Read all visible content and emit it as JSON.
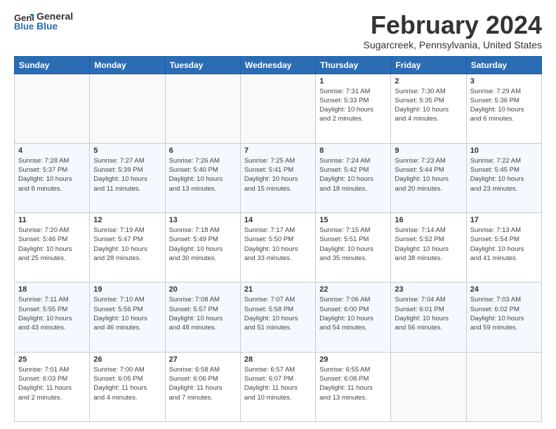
{
  "header": {
    "logo_general": "General",
    "logo_blue": "Blue",
    "month_title": "February 2024",
    "location": "Sugarcreek, Pennsylvania, United States"
  },
  "weekdays": [
    "Sunday",
    "Monday",
    "Tuesday",
    "Wednesday",
    "Thursday",
    "Friday",
    "Saturday"
  ],
  "weeks": [
    [
      {
        "day": "",
        "info": ""
      },
      {
        "day": "",
        "info": ""
      },
      {
        "day": "",
        "info": ""
      },
      {
        "day": "",
        "info": ""
      },
      {
        "day": "1",
        "info": "Sunrise: 7:31 AM\nSunset: 5:33 PM\nDaylight: 10 hours\nand 2 minutes."
      },
      {
        "day": "2",
        "info": "Sunrise: 7:30 AM\nSunset: 5:35 PM\nDaylight: 10 hours\nand 4 minutes."
      },
      {
        "day": "3",
        "info": "Sunrise: 7:29 AM\nSunset: 5:36 PM\nDaylight: 10 hours\nand 6 minutes."
      }
    ],
    [
      {
        "day": "4",
        "info": "Sunrise: 7:28 AM\nSunset: 5:37 PM\nDaylight: 10 hours\nand 8 minutes."
      },
      {
        "day": "5",
        "info": "Sunrise: 7:27 AM\nSunset: 5:39 PM\nDaylight: 10 hours\nand 11 minutes."
      },
      {
        "day": "6",
        "info": "Sunrise: 7:26 AM\nSunset: 5:40 PM\nDaylight: 10 hours\nand 13 minutes."
      },
      {
        "day": "7",
        "info": "Sunrise: 7:25 AM\nSunset: 5:41 PM\nDaylight: 10 hours\nand 15 minutes."
      },
      {
        "day": "8",
        "info": "Sunrise: 7:24 AM\nSunset: 5:42 PM\nDaylight: 10 hours\nand 18 minutes."
      },
      {
        "day": "9",
        "info": "Sunrise: 7:23 AM\nSunset: 5:44 PM\nDaylight: 10 hours\nand 20 minutes."
      },
      {
        "day": "10",
        "info": "Sunrise: 7:22 AM\nSunset: 5:45 PM\nDaylight: 10 hours\nand 23 minutes."
      }
    ],
    [
      {
        "day": "11",
        "info": "Sunrise: 7:20 AM\nSunset: 5:46 PM\nDaylight: 10 hours\nand 25 minutes."
      },
      {
        "day": "12",
        "info": "Sunrise: 7:19 AM\nSunset: 5:47 PM\nDaylight: 10 hours\nand 28 minutes."
      },
      {
        "day": "13",
        "info": "Sunrise: 7:18 AM\nSunset: 5:49 PM\nDaylight: 10 hours\nand 30 minutes."
      },
      {
        "day": "14",
        "info": "Sunrise: 7:17 AM\nSunset: 5:50 PM\nDaylight: 10 hours\nand 33 minutes."
      },
      {
        "day": "15",
        "info": "Sunrise: 7:15 AM\nSunset: 5:51 PM\nDaylight: 10 hours\nand 35 minutes."
      },
      {
        "day": "16",
        "info": "Sunrise: 7:14 AM\nSunset: 5:52 PM\nDaylight: 10 hours\nand 38 minutes."
      },
      {
        "day": "17",
        "info": "Sunrise: 7:13 AM\nSunset: 5:54 PM\nDaylight: 10 hours\nand 41 minutes."
      }
    ],
    [
      {
        "day": "18",
        "info": "Sunrise: 7:11 AM\nSunset: 5:55 PM\nDaylight: 10 hours\nand 43 minutes."
      },
      {
        "day": "19",
        "info": "Sunrise: 7:10 AM\nSunset: 5:56 PM\nDaylight: 10 hours\nand 46 minutes."
      },
      {
        "day": "20",
        "info": "Sunrise: 7:08 AM\nSunset: 5:57 PM\nDaylight: 10 hours\nand 48 minutes."
      },
      {
        "day": "21",
        "info": "Sunrise: 7:07 AM\nSunset: 5:58 PM\nDaylight: 10 hours\nand 51 minutes."
      },
      {
        "day": "22",
        "info": "Sunrise: 7:06 AM\nSunset: 6:00 PM\nDaylight: 10 hours\nand 54 minutes."
      },
      {
        "day": "23",
        "info": "Sunrise: 7:04 AM\nSunset: 6:01 PM\nDaylight: 10 hours\nand 56 minutes."
      },
      {
        "day": "24",
        "info": "Sunrise: 7:03 AM\nSunset: 6:02 PM\nDaylight: 10 hours\nand 59 minutes."
      }
    ],
    [
      {
        "day": "25",
        "info": "Sunrise: 7:01 AM\nSunset: 6:03 PM\nDaylight: 11 hours\nand 2 minutes."
      },
      {
        "day": "26",
        "info": "Sunrise: 7:00 AM\nSunset: 6:05 PM\nDaylight: 11 hours\nand 4 minutes."
      },
      {
        "day": "27",
        "info": "Sunrise: 6:58 AM\nSunset: 6:06 PM\nDaylight: 11 hours\nand 7 minutes."
      },
      {
        "day": "28",
        "info": "Sunrise: 6:57 AM\nSunset: 6:07 PM\nDaylight: 11 hours\nand 10 minutes."
      },
      {
        "day": "29",
        "info": "Sunrise: 6:55 AM\nSunset: 6:08 PM\nDaylight: 11 hours\nand 13 minutes."
      },
      {
        "day": "",
        "info": ""
      },
      {
        "day": "",
        "info": ""
      }
    ]
  ]
}
